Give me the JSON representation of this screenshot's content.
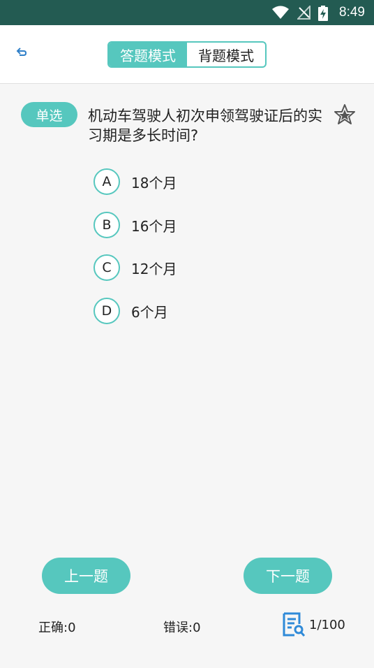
{
  "status_bar": {
    "time": "8:49",
    "icons": [
      "wifi-icon",
      "no-signal-icon",
      "battery-charging-icon"
    ]
  },
  "header": {
    "back_icon": "back-arrow-icon",
    "mode_tabs": [
      {
        "label": "答题模式",
        "active": true
      },
      {
        "label": "背题模式",
        "active": false
      }
    ]
  },
  "question": {
    "type_tag": "单选",
    "text": "机动车驾驶人初次申领驾驶证后的实习期是多长时间?",
    "favorite_icon": "star-icon",
    "options": [
      {
        "letter": "A",
        "text": "18个月"
      },
      {
        "letter": "B",
        "text": "16个月"
      },
      {
        "letter": "C",
        "text": "12个月"
      },
      {
        "letter": "D",
        "text": "6个月"
      }
    ]
  },
  "footer": {
    "prev_label": "上一题",
    "next_label": "下一题",
    "correct": "正确:0",
    "wrong": "错误:0",
    "progress": "1/100",
    "progress_icon": "question-list-icon"
  },
  "colors": {
    "accent": "#56c7be",
    "status_bar": "#235b52"
  }
}
